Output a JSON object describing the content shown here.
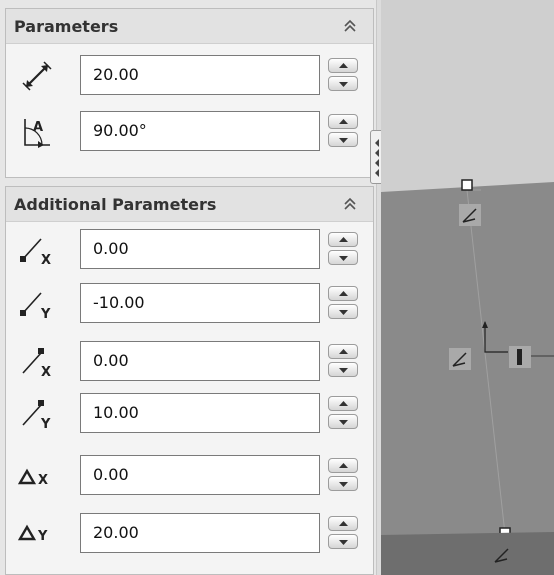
{
  "parameters": {
    "title": "Parameters",
    "rows": [
      {
        "icon": "distance-icon",
        "value": "20.00"
      },
      {
        "icon": "angle-icon",
        "value": "90.00°"
      }
    ]
  },
  "additional": {
    "title": "Additional Parameters",
    "rows": [
      {
        "icon": "start-point-x-icon",
        "value": "0.00"
      },
      {
        "icon": "start-point-y-icon",
        "value": "-10.00"
      },
      {
        "icon": "end-point-x-icon",
        "value": "0.00"
      },
      {
        "icon": "end-point-y-icon",
        "value": "10.00"
      },
      {
        "icon": "delta-x-icon",
        "value": "0.00"
      },
      {
        "icon": "delta-y-icon",
        "value": "20.00"
      }
    ]
  },
  "colors": {
    "viewport_fill": "#8a8a8a",
    "viewport_bg": "#cfcfcf",
    "sketch_line": "#555555"
  }
}
